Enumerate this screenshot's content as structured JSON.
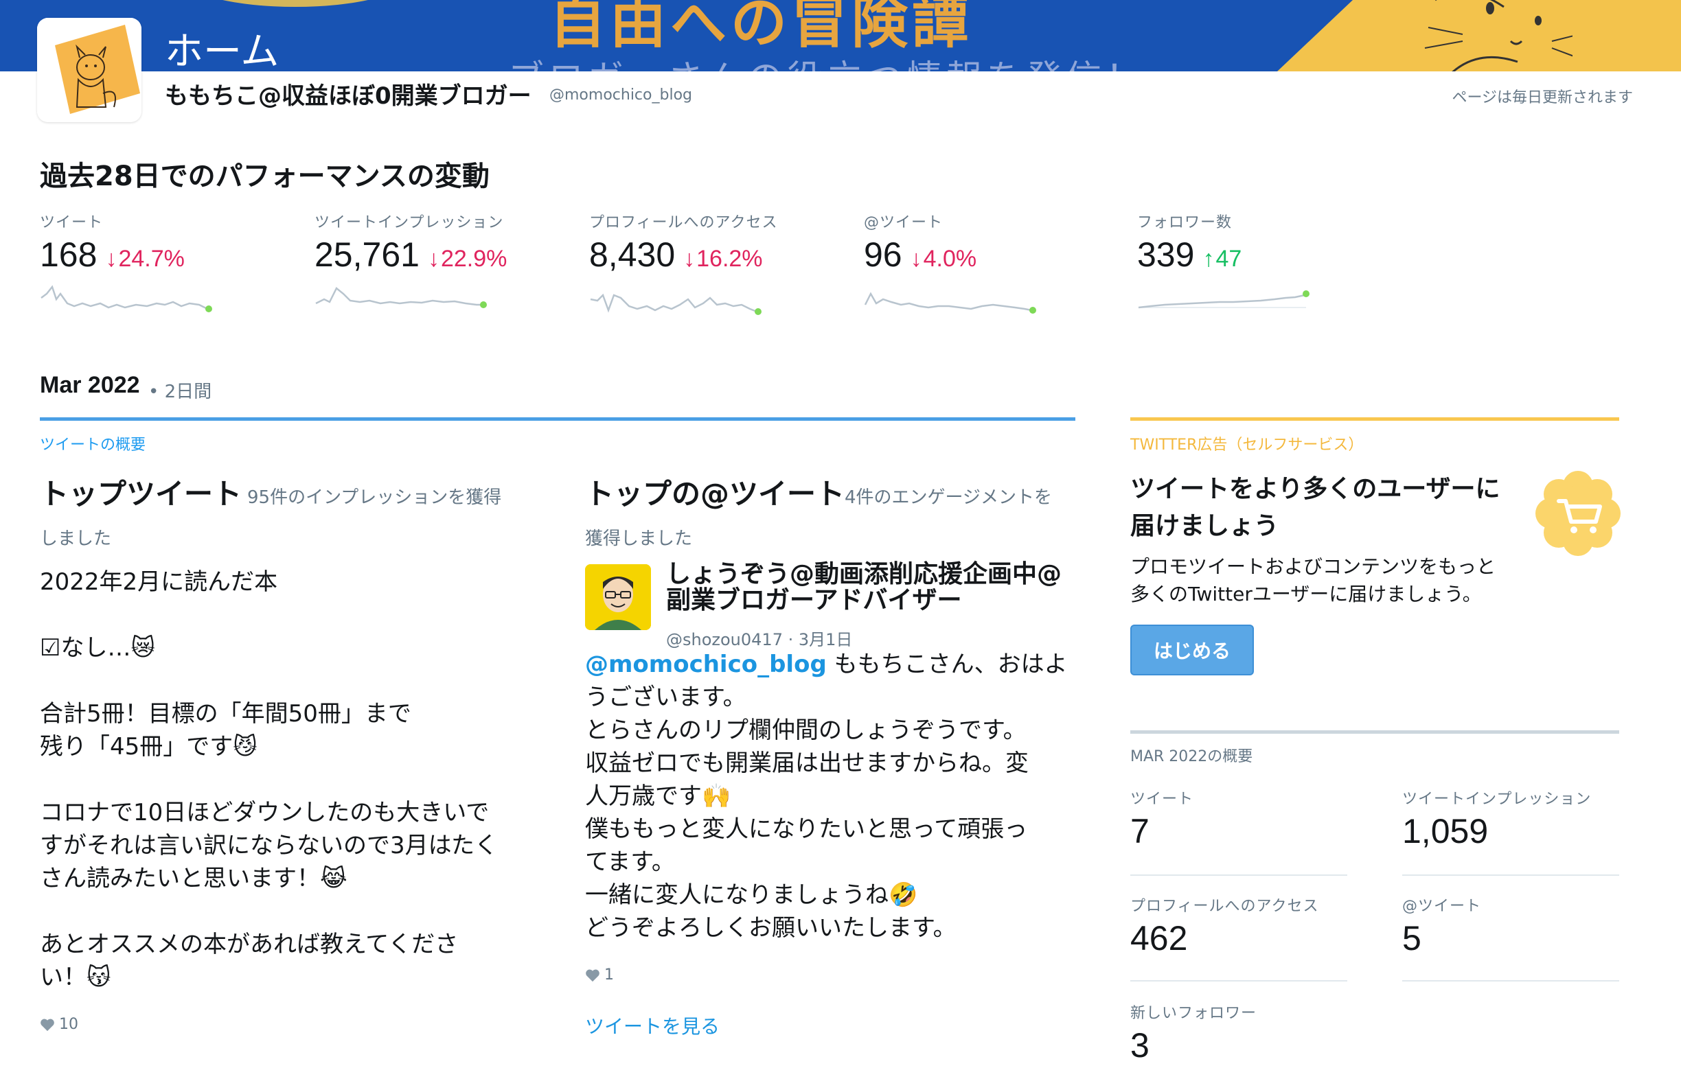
{
  "header": {
    "title": "ホーム",
    "banner_text_top": "自由への冒険譚",
    "banner_text_sub": "ブロガーさんの役立つ情報を発信！",
    "profile_name": "ももちこ@収益ほぼ0開業ブロガー",
    "profile_handle": "@momochico_blog",
    "update_note": "ページは毎日更新されます"
  },
  "performance": {
    "title": "過去28日でのパフォーマンスの変動",
    "metrics": [
      {
        "label": "ツイート",
        "value": "168",
        "arrow": "↓",
        "change": "24.7%",
        "direction": "down"
      },
      {
        "label": "ツイートインプレッション",
        "value": "25,761",
        "arrow": "↓",
        "change": "22.9%",
        "direction": "down"
      },
      {
        "label": "プロフィールへのアクセス",
        "value": "8,430",
        "arrow": "↓",
        "change": "16.2%",
        "direction": "down"
      },
      {
        "label": "@ツイート",
        "value": "96",
        "arrow": "↓",
        "change": "4.0%",
        "direction": "down"
      },
      {
        "label": "フォロワー数",
        "value": "339",
        "arrow": "↑",
        "change": "47",
        "direction": "up"
      }
    ],
    "colors": {
      "down": "#e0245e",
      "up": "#17bf63",
      "sparkline": "#b8c4ce",
      "sparkline_end": "#7ed957"
    }
  },
  "month": {
    "title": "Mar 2022",
    "days": "• 2日間"
  },
  "tweet_summary": {
    "section_label": "ツイートの概要",
    "top_tweet": {
      "heading": "トップツイート",
      "sub_line1": "95件のインプレッションを獲得",
      "sub_line2": "しました",
      "lines": [
        "2022年2月に読んだ本",
        "",
        "☑なし…😿",
        "",
        "合計5冊！目標の「年間50冊」まで",
        "残り「45冊」です😼",
        "",
        "コロナで10日ほどダウンしたのも大きいで",
        "すがそれは言い訳にならないので3月はたく",
        "さん読みたいと思います！😹",
        "",
        "あとオススメの本があれば教えてくださ",
        "い！😽"
      ],
      "likes": "10"
    },
    "top_mention": {
      "heading": "トップの@ツイート",
      "sub_line1": "4件のエンゲージメントを",
      "sub_line2": "獲得しました",
      "author_name_line1": "しょうぞう@動画添削応援企画中@",
      "author_name_line2": "副業ブロガーアドバイザー",
      "author_handle": "@shozou0417",
      "date": "· 3月1日",
      "mention": "@momochico_blog",
      "first_line_rest": " ももちこさん、おはよ",
      "lines": [
        "うございます。",
        "とらさんのリプ欄仲間のしょうぞうです。",
        "収益ゼロでも開業届は出せますからね。変",
        "人万歳です🙌",
        "僕ももっと変人になりたいと思って頑張っ",
        "てます。",
        "一緒に変人になりましょうね🤣",
        "どうぞよろしくお願いいたします。"
      ],
      "likes": "1",
      "view_link": "ツイートを見る"
    }
  },
  "ads": {
    "section_label": "TWITTER広告（セルフサービス）",
    "heading_line1": "ツイートをより多くのユーザーに",
    "heading_line2": "届けましょう",
    "desc_line1": "プロモツイートおよびコンテンツをもっと",
    "desc_line2": "多くのTwitterユーザーに届けましょう。",
    "button_label": "はじめる",
    "accent": "#f9c74f"
  },
  "month_summary": {
    "label": "MAR 2022の概要",
    "stats": [
      {
        "label": "ツイート",
        "value": "7"
      },
      {
        "label": "ツイートインプレッション",
        "value": "1,059"
      },
      {
        "label": "プロフィールへのアクセス",
        "value": "462"
      },
      {
        "label": "@ツイート",
        "value": "5"
      },
      {
        "label": "新しいフォロワー",
        "value": "3"
      }
    ]
  }
}
